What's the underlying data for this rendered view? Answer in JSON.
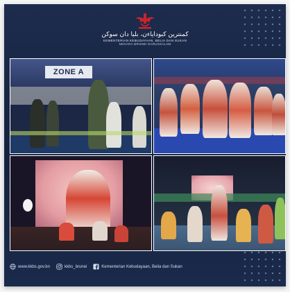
{
  "header": {
    "ministry_jawi": "كمنترين كبوداياءن، بليا دان سوكن",
    "ministry_name": "KEMENTERIAN KEBUDAYAAN, BELIA DAN SUKAN",
    "ministry_country": "NEGARA BRUNEI DARUSSALAM"
  },
  "photos": [
    {
      "zone_sign": "ZONE A"
    },
    {},
    {},
    {}
  ],
  "footer": {
    "website": "www.kkbs.gov.bn",
    "instagram": "kkbs_brunei",
    "facebook": "Kementerian Kebudayaan, Belia dan Sukan"
  },
  "colors": {
    "card_bg": "#1d2c4d",
    "crest_red": "#c9242d",
    "photo_border": "#ffffff"
  },
  "icons": {
    "crest": "ministry-crest-icon",
    "website": "globe-icon",
    "instagram": "instagram-icon",
    "facebook": "facebook-icon"
  }
}
